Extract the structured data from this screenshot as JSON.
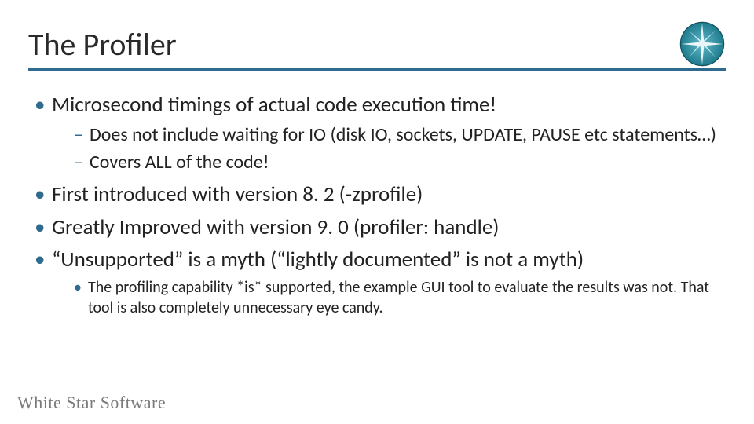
{
  "title": "The Profiler",
  "logo_name": "compass-star-logo",
  "bullets": [
    {
      "text": "Microsecond timings of actual code execution time!",
      "sub": [
        {
          "text": "Does not include waiting for IO (disk IO, sockets, UPDATE, PAUSE etc statements…)"
        },
        {
          "text": "Covers ALL of the code!"
        }
      ]
    },
    {
      "text": "First introduced with version 8. 2 (-zprofile)"
    },
    {
      "text": "Greatly Improved with version 9. 0 (profiler: handle)"
    },
    {
      "text": "“Unsupported” is a myth (“lightly documented” is not a myth)",
      "subsub": [
        {
          "text": "The profiling capability *is* supported, the example GUI tool to evaluate the results was not.  That tool is also completely unnecessary eye candy."
        }
      ]
    }
  ],
  "footer": "White Star Software"
}
